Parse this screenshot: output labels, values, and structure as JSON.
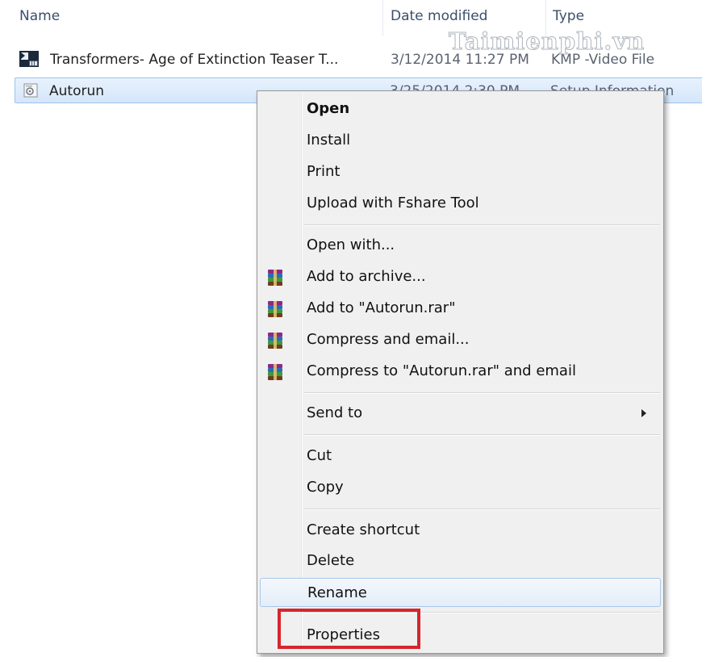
{
  "header": {
    "name": "Name",
    "date_modified": "Date modified",
    "type": "Type"
  },
  "watermark": "Taimienphi.vn",
  "files": [
    {
      "name": "Transformers- Age of Extinction Teaser T...",
      "date": "3/12/2014 11:27 PM",
      "type": "KMP -Video File",
      "icon": "kmp-video-icon",
      "selected": false
    },
    {
      "name": "Autorun",
      "date": "3/25/2014 2:30 PM",
      "type": "Setup Information",
      "icon": "setup-info-icon",
      "selected": true
    }
  ],
  "context_menu": {
    "items": [
      {
        "label": "Open",
        "bold": true
      },
      {
        "label": "Install"
      },
      {
        "label": "Print"
      },
      {
        "label": "Upload with Fshare Tool"
      },
      {
        "label": "Open with..."
      },
      {
        "label": "Add to archive...",
        "icon": "winrar-icon"
      },
      {
        "label": "Add to \"Autorun.rar\"",
        "icon": "winrar-icon"
      },
      {
        "label": "Compress and email...",
        "icon": "winrar-icon"
      },
      {
        "label": "Compress to \"Autorun.rar\" and email",
        "icon": "winrar-icon"
      },
      {
        "label": "Send to",
        "submenu": true
      },
      {
        "label": "Cut"
      },
      {
        "label": "Copy"
      },
      {
        "label": "Create shortcut"
      },
      {
        "label": "Delete"
      },
      {
        "label": "Rename",
        "hovered": true
      },
      {
        "label": "Properties",
        "highlighted": true
      }
    ]
  },
  "colors": {
    "highlight_box": "#d6262d",
    "selection": "#d4e6fa",
    "menu_background": "#f0f0f0"
  }
}
